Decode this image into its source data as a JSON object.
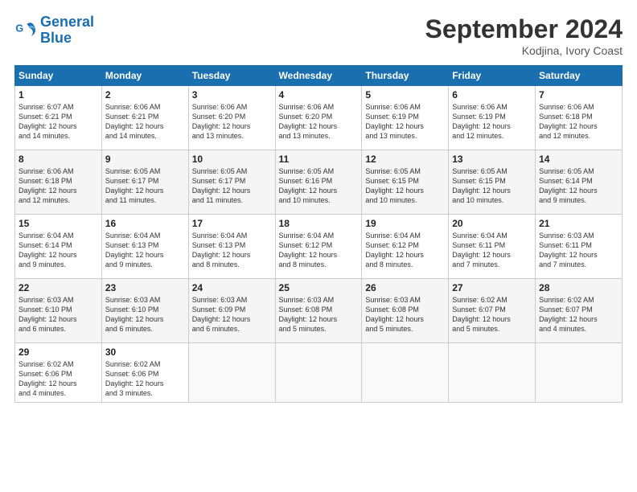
{
  "header": {
    "logo_line1": "General",
    "logo_line2": "Blue",
    "month": "September 2024",
    "location": "Kodjina, Ivory Coast"
  },
  "weekdays": [
    "Sunday",
    "Monday",
    "Tuesday",
    "Wednesday",
    "Thursday",
    "Friday",
    "Saturday"
  ],
  "weeks": [
    [
      {
        "day": "1",
        "info": "Sunrise: 6:07 AM\nSunset: 6:21 PM\nDaylight: 12 hours\nand 14 minutes."
      },
      {
        "day": "2",
        "info": "Sunrise: 6:06 AM\nSunset: 6:21 PM\nDaylight: 12 hours\nand 14 minutes."
      },
      {
        "day": "3",
        "info": "Sunrise: 6:06 AM\nSunset: 6:20 PM\nDaylight: 12 hours\nand 13 minutes."
      },
      {
        "day": "4",
        "info": "Sunrise: 6:06 AM\nSunset: 6:20 PM\nDaylight: 12 hours\nand 13 minutes."
      },
      {
        "day": "5",
        "info": "Sunrise: 6:06 AM\nSunset: 6:19 PM\nDaylight: 12 hours\nand 13 minutes."
      },
      {
        "day": "6",
        "info": "Sunrise: 6:06 AM\nSunset: 6:19 PM\nDaylight: 12 hours\nand 12 minutes."
      },
      {
        "day": "7",
        "info": "Sunrise: 6:06 AM\nSunset: 6:18 PM\nDaylight: 12 hours\nand 12 minutes."
      }
    ],
    [
      {
        "day": "8",
        "info": "Sunrise: 6:06 AM\nSunset: 6:18 PM\nDaylight: 12 hours\nand 12 minutes."
      },
      {
        "day": "9",
        "info": "Sunrise: 6:05 AM\nSunset: 6:17 PM\nDaylight: 12 hours\nand 11 minutes."
      },
      {
        "day": "10",
        "info": "Sunrise: 6:05 AM\nSunset: 6:17 PM\nDaylight: 12 hours\nand 11 minutes."
      },
      {
        "day": "11",
        "info": "Sunrise: 6:05 AM\nSunset: 6:16 PM\nDaylight: 12 hours\nand 10 minutes."
      },
      {
        "day": "12",
        "info": "Sunrise: 6:05 AM\nSunset: 6:15 PM\nDaylight: 12 hours\nand 10 minutes."
      },
      {
        "day": "13",
        "info": "Sunrise: 6:05 AM\nSunset: 6:15 PM\nDaylight: 12 hours\nand 10 minutes."
      },
      {
        "day": "14",
        "info": "Sunrise: 6:05 AM\nSunset: 6:14 PM\nDaylight: 12 hours\nand 9 minutes."
      }
    ],
    [
      {
        "day": "15",
        "info": "Sunrise: 6:04 AM\nSunset: 6:14 PM\nDaylight: 12 hours\nand 9 minutes."
      },
      {
        "day": "16",
        "info": "Sunrise: 6:04 AM\nSunset: 6:13 PM\nDaylight: 12 hours\nand 9 minutes."
      },
      {
        "day": "17",
        "info": "Sunrise: 6:04 AM\nSunset: 6:13 PM\nDaylight: 12 hours\nand 8 minutes."
      },
      {
        "day": "18",
        "info": "Sunrise: 6:04 AM\nSunset: 6:12 PM\nDaylight: 12 hours\nand 8 minutes."
      },
      {
        "day": "19",
        "info": "Sunrise: 6:04 AM\nSunset: 6:12 PM\nDaylight: 12 hours\nand 8 minutes."
      },
      {
        "day": "20",
        "info": "Sunrise: 6:04 AM\nSunset: 6:11 PM\nDaylight: 12 hours\nand 7 minutes."
      },
      {
        "day": "21",
        "info": "Sunrise: 6:03 AM\nSunset: 6:11 PM\nDaylight: 12 hours\nand 7 minutes."
      }
    ],
    [
      {
        "day": "22",
        "info": "Sunrise: 6:03 AM\nSunset: 6:10 PM\nDaylight: 12 hours\nand 6 minutes."
      },
      {
        "day": "23",
        "info": "Sunrise: 6:03 AM\nSunset: 6:10 PM\nDaylight: 12 hours\nand 6 minutes."
      },
      {
        "day": "24",
        "info": "Sunrise: 6:03 AM\nSunset: 6:09 PM\nDaylight: 12 hours\nand 6 minutes."
      },
      {
        "day": "25",
        "info": "Sunrise: 6:03 AM\nSunset: 6:08 PM\nDaylight: 12 hours\nand 5 minutes."
      },
      {
        "day": "26",
        "info": "Sunrise: 6:03 AM\nSunset: 6:08 PM\nDaylight: 12 hours\nand 5 minutes."
      },
      {
        "day": "27",
        "info": "Sunrise: 6:02 AM\nSunset: 6:07 PM\nDaylight: 12 hours\nand 5 minutes."
      },
      {
        "day": "28",
        "info": "Sunrise: 6:02 AM\nSunset: 6:07 PM\nDaylight: 12 hours\nand 4 minutes."
      }
    ],
    [
      {
        "day": "29",
        "info": "Sunrise: 6:02 AM\nSunset: 6:06 PM\nDaylight: 12 hours\nand 4 minutes."
      },
      {
        "day": "30",
        "info": "Sunrise: 6:02 AM\nSunset: 6:06 PM\nDaylight: 12 hours\nand 3 minutes."
      },
      {
        "day": "",
        "info": ""
      },
      {
        "day": "",
        "info": ""
      },
      {
        "day": "",
        "info": ""
      },
      {
        "day": "",
        "info": ""
      },
      {
        "day": "",
        "info": ""
      }
    ]
  ]
}
